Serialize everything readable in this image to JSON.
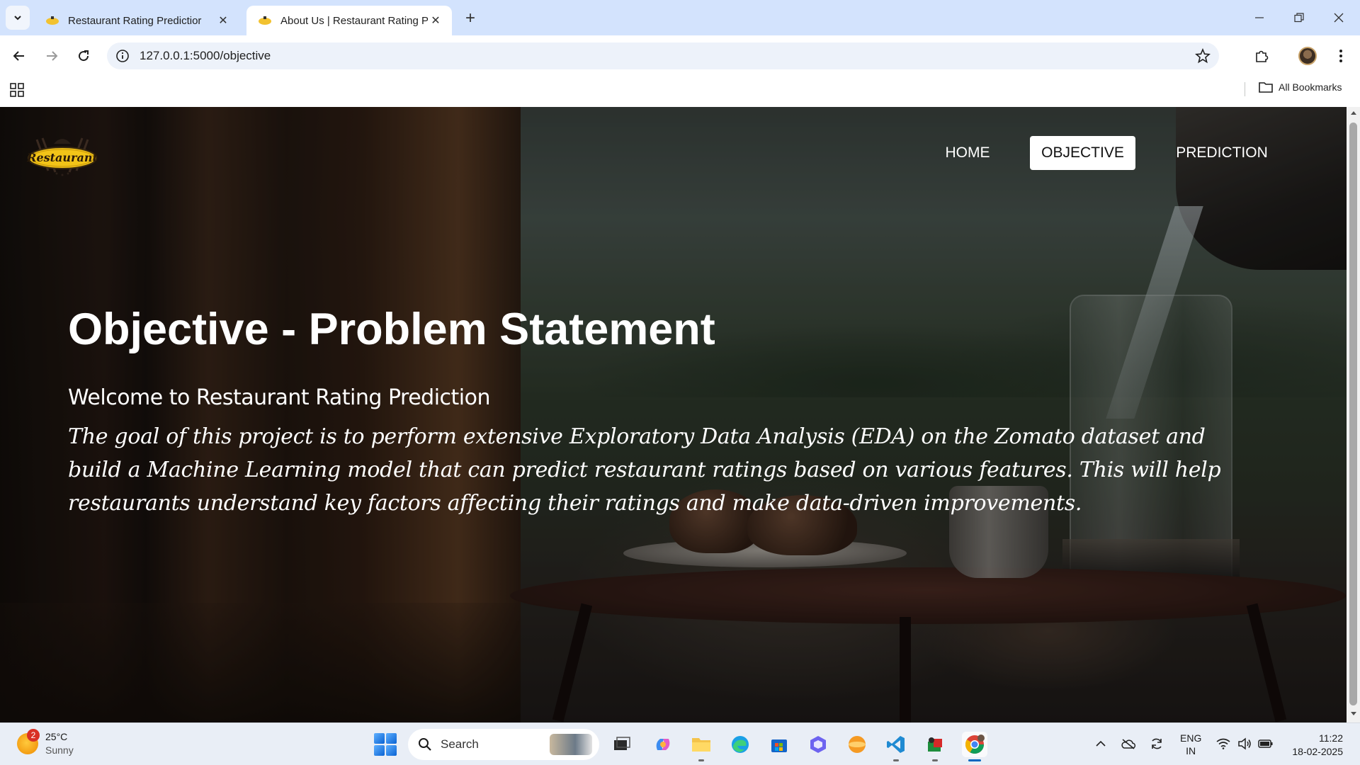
{
  "browser": {
    "tabs": [
      {
        "title": "Restaurant Rating Predictior",
        "active": false
      },
      {
        "title": "About Us | Restaurant Rating Pr",
        "active": true
      }
    ],
    "url": "127.0.0.1:5000/objective",
    "bookmarks_label": "All Bookmarks"
  },
  "page": {
    "logo_text": "Restaurant",
    "nav": {
      "home": "HOME",
      "objective": "OBJECTIVE",
      "prediction": "PREDICTION",
      "active": "objective"
    },
    "title": "Objective - Problem Statement",
    "welcome": "Welcome to Restaurant Rating Prediction",
    "description": "The goal of this project is to perform extensive Exploratory Data Analysis (EDA) on the Zomato dataset and build a Machine Learning model that can predict restaurant ratings based on various features. This will help restaurants understand key factors affecting their ratings and make data-driven improvements."
  },
  "taskbar": {
    "weather": {
      "temp": "25°C",
      "condition": "Sunny",
      "badge": "2"
    },
    "search_placeholder": "Search",
    "language": {
      "line1": "ENG",
      "line2": "IN"
    },
    "clock": {
      "time": "11:22",
      "date": "18-02-2025"
    }
  },
  "colors": {
    "accent": "#0067c0",
    "nav_active_bg": "#ffffff",
    "tabstrip": "#d3e3fd"
  }
}
